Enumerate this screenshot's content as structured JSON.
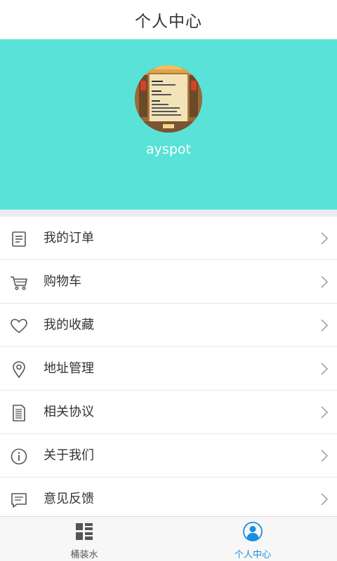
{
  "header": {
    "title": "个人中心"
  },
  "profile": {
    "username": "ayspot"
  },
  "menu": {
    "items": [
      {
        "label": "我的订单",
        "icon": "order-list-icon"
      },
      {
        "label": "购物车",
        "icon": "shopping-cart-icon"
      },
      {
        "label": "我的收藏",
        "icon": "heart-icon"
      },
      {
        "label": "地址管理",
        "icon": "location-pin-icon"
      },
      {
        "label": "相关协议",
        "icon": "document-icon"
      },
      {
        "label": "关于我们",
        "icon": "info-icon"
      },
      {
        "label": "意见反馈",
        "icon": "chat-bubble-icon"
      }
    ]
  },
  "tabbar": {
    "tabs": [
      {
        "label": "桶装水",
        "icon": "grid-list-icon",
        "active": false
      },
      {
        "label": "个人中心",
        "icon": "user-profile-icon",
        "active": true
      }
    ],
    "active_color": "#1a8ee0",
    "inactive_color": "#555555"
  },
  "colors": {
    "header_bg": "#59e2d8",
    "divider": "#e6e6e6"
  }
}
